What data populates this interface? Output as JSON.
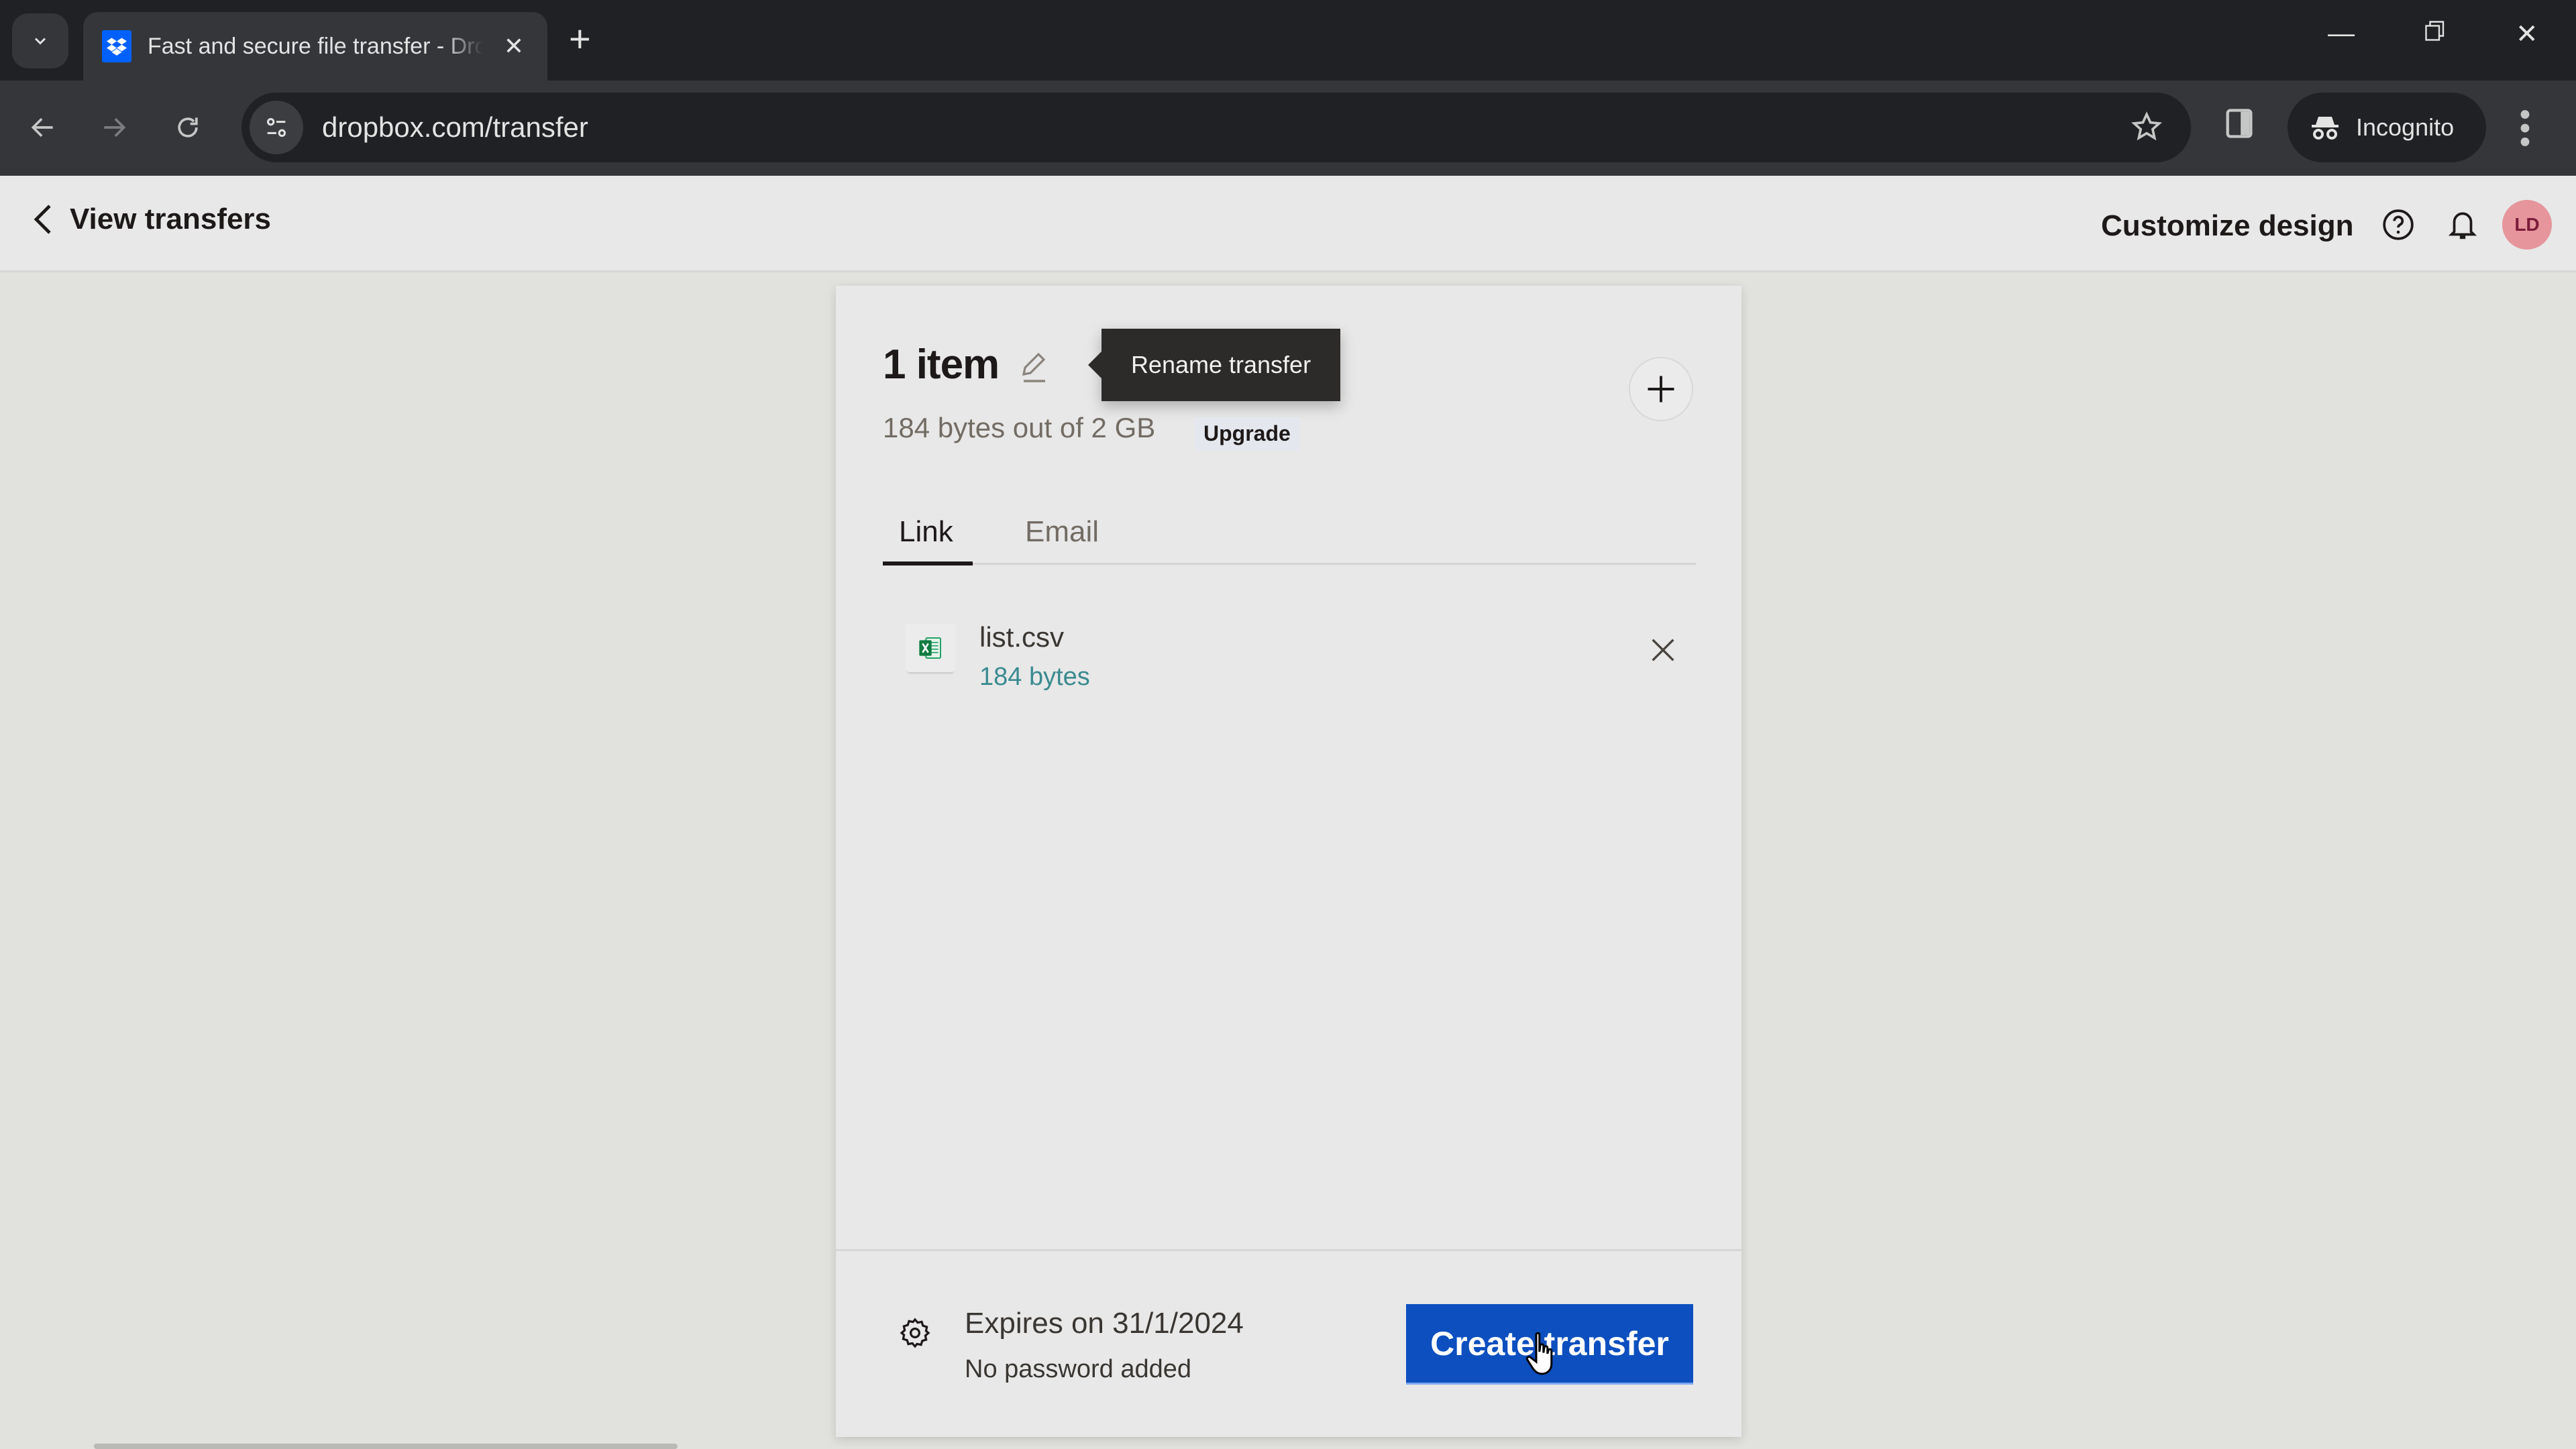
{
  "browser": {
    "tab": {
      "title": "Fast and secure file transfer - Dropbox",
      "favicon": "dropbox-icon"
    },
    "url": "dropbox.com/transfer",
    "incognito_label": "Incognito",
    "window_controls": [
      "minimize",
      "restore",
      "close"
    ]
  },
  "header": {
    "back_label": "View transfers",
    "customize_label": "Customize design",
    "avatar_initials": "LD",
    "avatar_color": "#e5959b"
  },
  "transfer": {
    "title": "1 item",
    "tooltip": "Rename transfer",
    "usage": "184 bytes out of 2 GB",
    "upgrade_label": "Upgrade",
    "tabs": [
      {
        "label": "Link",
        "active": true
      },
      {
        "label": "Email",
        "active": false
      }
    ],
    "files": [
      {
        "name": "list.csv",
        "size": "184 bytes",
        "icon": "excel-icon"
      }
    ],
    "expires": "Expires on 31/1/2024",
    "password": "No password added",
    "create_label": "Create transfer",
    "accent_color": "#0d4fbf"
  }
}
